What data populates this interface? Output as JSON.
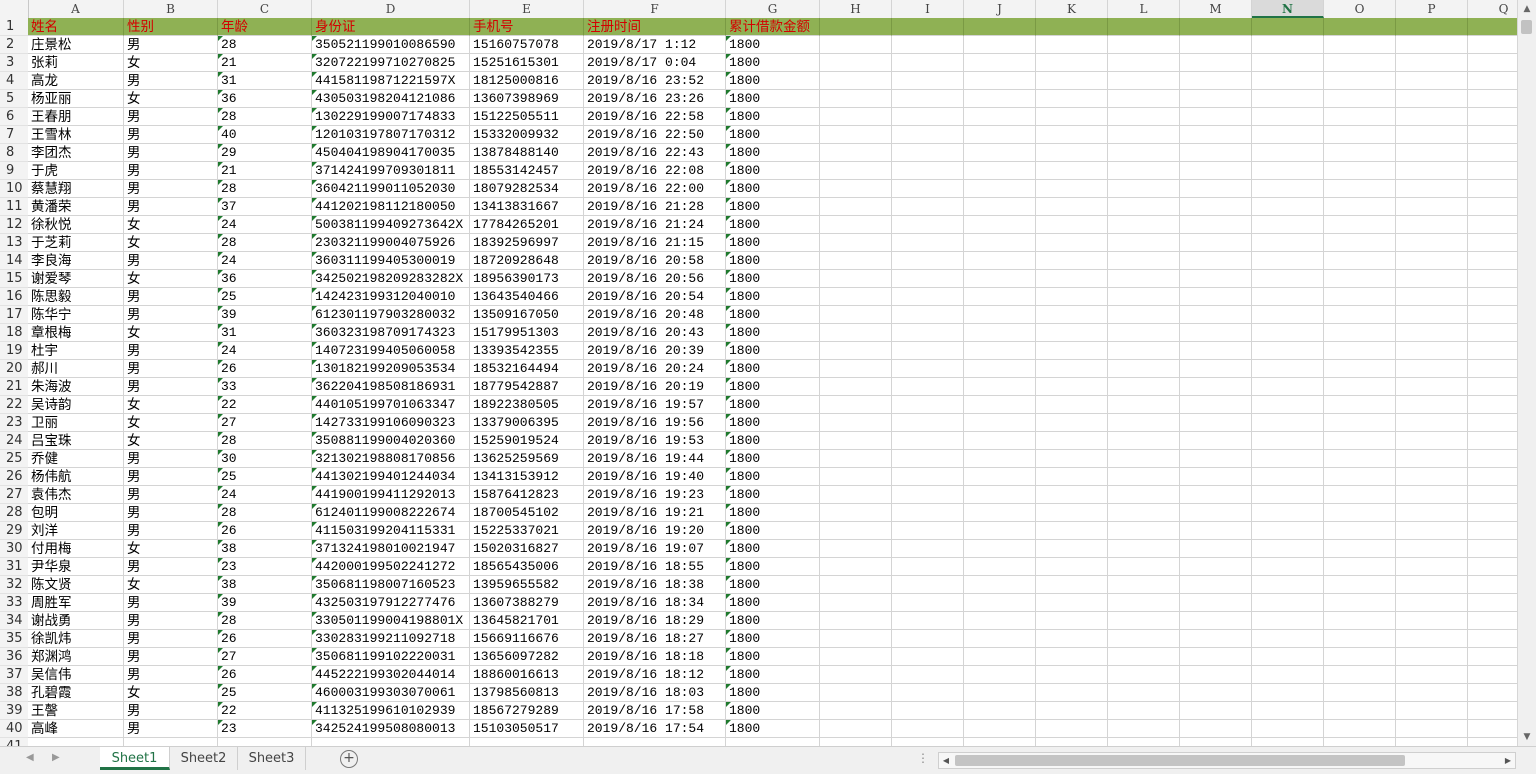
{
  "spreadsheet": {
    "column_letters": [
      "A",
      "B",
      "C",
      "D",
      "E",
      "F",
      "G",
      "H",
      "I",
      "J",
      "K",
      "L",
      "M",
      "N",
      "O",
      "P",
      "Q"
    ],
    "selected_column": "N",
    "header_fill_color": "#8fb154",
    "header_text_color": "#d40000",
    "headers": [
      "姓名",
      "性别",
      "年龄",
      "身份证",
      "手机号",
      "注册时间",
      "累计借款金额"
    ],
    "row_numbers": [
      "1",
      "2",
      "3",
      "4",
      "5",
      "6",
      "7",
      "8",
      "9",
      "10",
      "11",
      "12",
      "13",
      "14",
      "15",
      "16",
      "17",
      "18",
      "19",
      "20",
      "21",
      "22",
      "23",
      "24",
      "25",
      "26",
      "27",
      "28",
      "29",
      "30",
      "31",
      "32",
      "33",
      "34",
      "35",
      "36",
      "37",
      "38",
      "39",
      "40",
      "41"
    ],
    "rows": [
      [
        "庄景松",
        "男",
        "28",
        "350521199010086590",
        "15160757078",
        "2019/8/17 1:12",
        "1800"
      ],
      [
        "张莉",
        "女",
        "21",
        "320722199710270825",
        "15251615301",
        "2019/8/17 0:04",
        "1800"
      ],
      [
        "高龙",
        "男",
        "31",
        "44158119871221597X",
        "18125000816",
        "2019/8/16 23:52",
        "1800"
      ],
      [
        "杨亚丽",
        "女",
        "36",
        "430503198204121086",
        "13607398969",
        "2019/8/16 23:26",
        "1800"
      ],
      [
        "王春朋",
        "男",
        "28",
        "130229199007174833",
        "15122505511",
        "2019/8/16 22:58",
        "1800"
      ],
      [
        "王雪林",
        "男",
        "40",
        "120103197807170312",
        "15332009932",
        "2019/8/16 22:50",
        "1800"
      ],
      [
        "李团杰",
        "男",
        "29",
        "450404198904170035",
        "13878488140",
        "2019/8/16 22:43",
        "1800"
      ],
      [
        "于虎",
        "男",
        "21",
        "371424199709301811",
        "18553142457",
        "2019/8/16 22:08",
        "1800"
      ],
      [
        "蔡慧翔",
        "男",
        "28",
        "360421199011052030",
        "18079282534",
        "2019/8/16 22:00",
        "1800"
      ],
      [
        "黄潘荣",
        "男",
        "37",
        "441202198112180050",
        "13413831667",
        "2019/8/16 21:28",
        "1800"
      ],
      [
        "徐秋悦",
        "女",
        "24",
        "500381199409273642X",
        "17784265201",
        "2019/8/16 21:24",
        "1800"
      ],
      [
        "于芝莉",
        "女",
        "28",
        "230321199004075926",
        "18392596997",
        "2019/8/16 21:15",
        "1800"
      ],
      [
        "李良海",
        "男",
        "24",
        "360311199405300019",
        "18720928648",
        "2019/8/16 20:58",
        "1800"
      ],
      [
        "谢爱琴",
        "女",
        "36",
        "342502198209283282X",
        "18956390173",
        "2019/8/16 20:56",
        "1800"
      ],
      [
        "陈思毅",
        "男",
        "25",
        "142423199312040010",
        "13643540466",
        "2019/8/16 20:54",
        "1800"
      ],
      [
        "陈华宁",
        "男",
        "39",
        "612301197903280032",
        "13509167050",
        "2019/8/16 20:48",
        "1800"
      ],
      [
        "章根梅",
        "女",
        "31",
        "360323198709174323",
        "15179951303",
        "2019/8/16 20:43",
        "1800"
      ],
      [
        "杜宇",
        "男",
        "24",
        "140723199405060058",
        "13393542355",
        "2019/8/16 20:39",
        "1800"
      ],
      [
        "郝川",
        "男",
        "26",
        "130182199209053534",
        "18532164494",
        "2019/8/16 20:24",
        "1800"
      ],
      [
        "朱海波",
        "男",
        "33",
        "362204198508186931",
        "18779542887",
        "2019/8/16 20:19",
        "1800"
      ],
      [
        "吴诗韵",
        "女",
        "22",
        "440105199701063347",
        "18922380505",
        "2019/8/16 19:57",
        "1800"
      ],
      [
        "卫丽",
        "女",
        "27",
        "142733199106090323",
        "13379006395",
        "2019/8/16 19:56",
        "1800"
      ],
      [
        "吕宝珠",
        "女",
        "28",
        "350881199004020360",
        "15259019524",
        "2019/8/16 19:53",
        "1800"
      ],
      [
        "乔健",
        "男",
        "30",
        "321302198808170856",
        "13625259569",
        "2019/8/16 19:44",
        "1800"
      ],
      [
        "杨伟航",
        "男",
        "25",
        "441302199401244034",
        "13413153912",
        "2019/8/16 19:40",
        "1800"
      ],
      [
        "袁伟杰",
        "男",
        "24",
        "441900199411292013",
        "15876412823",
        "2019/8/16 19:23",
        "1800"
      ],
      [
        "包明",
        "男",
        "28",
        "612401199008222674",
        "18700545102",
        "2019/8/16 19:21",
        "1800"
      ],
      [
        "刘洋",
        "男",
        "26",
        "411503199204115331",
        "15225337021",
        "2019/8/16 19:20",
        "1800"
      ],
      [
        "付用梅",
        "女",
        "38",
        "371324198010021947",
        "15020316827",
        "2019/8/16 19:07",
        "1800"
      ],
      [
        "尹华泉",
        "男",
        "23",
        "442000199502241272",
        "18565435006",
        "2019/8/16 18:55",
        "1800"
      ],
      [
        "陈文贤",
        "女",
        "38",
        "350681198007160523",
        "13959655582",
        "2019/8/16 18:38",
        "1800"
      ],
      [
        "周胜军",
        "男",
        "39",
        "432503197912277476",
        "13607388279",
        "2019/8/16 18:34",
        "1800"
      ],
      [
        "谢战勇",
        "男",
        "28",
        "330501199004198801X",
        "13645821701",
        "2019/8/16 18:29",
        "1800"
      ],
      [
        "徐凯炜",
        "男",
        "26",
        "330283199211092718",
        "15669116676",
        "2019/8/16 18:27",
        "1800"
      ],
      [
        "郑渊鸿",
        "男",
        "27",
        "350681199102220031",
        "13656097282",
        "2019/8/16 18:18",
        "1800"
      ],
      [
        "吴信伟",
        "男",
        "26",
        "445222199302044014",
        "18860016613",
        "2019/8/16 18:12",
        "1800"
      ],
      [
        "孔碧霞",
        "女",
        "25",
        "460003199303070061",
        "13798560813",
        "2019/8/16 18:03",
        "1800"
      ],
      [
        "王謦",
        "男",
        "22",
        "411325199610102939",
        "18567279289",
        "2019/8/16 17:58",
        "1800"
      ],
      [
        "高峰",
        "男",
        "23",
        "342524199508080013",
        "15103050517",
        "2019/8/16 17:54",
        "1800"
      ]
    ]
  },
  "tabs": {
    "items": [
      "Sheet1",
      "Sheet2",
      "Sheet3"
    ],
    "active": "Sheet1",
    "add_symbol": "+",
    "options_symbol": "⋮"
  },
  "colors": {
    "accent": "#217346",
    "gridline": "#d4d4d4"
  }
}
